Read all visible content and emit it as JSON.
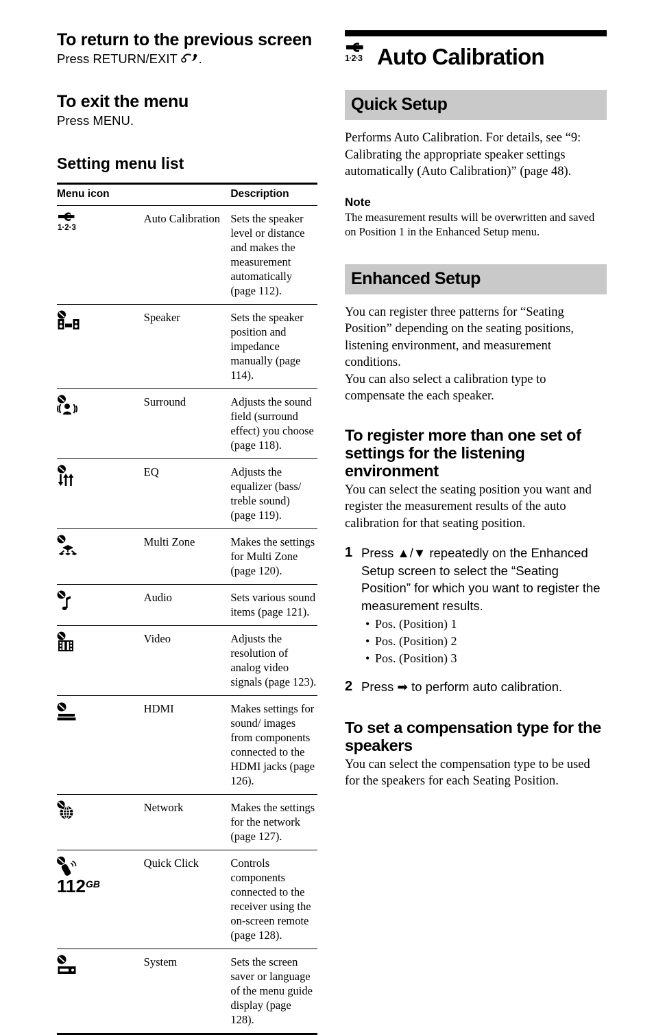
{
  "page": {
    "number": "112",
    "region_suffix": "GB"
  },
  "left_column": {
    "section1": {
      "heading": "To return to the previous screen",
      "body_prefix": "Press RETURN/EXIT ",
      "body_icon": "return-exit-icon",
      "body_suffix": "."
    },
    "section2": {
      "heading": "To exit the menu",
      "body": "Press MENU."
    },
    "section3": {
      "heading": "Setting menu list"
    },
    "table": {
      "columns": [
        "Menu icon",
        "Description"
      ],
      "rows": [
        {
          "icon": "auto-calibration-icon",
          "name": "Auto Calibration",
          "description": "Sets the speaker level or distance and makes the measurement automatically (page 112)."
        },
        {
          "icon": "speaker-icon",
          "name": "Speaker",
          "description": "Sets the speaker position and impedance manually (page 114)."
        },
        {
          "icon": "surround-icon",
          "name": "Surround",
          "description": "Adjusts the sound field (surround effect) you choose (page 118)."
        },
        {
          "icon": "eq-icon",
          "name": "EQ",
          "description": "Adjusts the equalizer (bass/ treble sound) (page 119)."
        },
        {
          "icon": "multi-zone-icon",
          "name": "Multi Zone",
          "description": "Makes the settings for Multi Zone (page 120)."
        },
        {
          "icon": "audio-icon",
          "name": "Audio",
          "description": "Sets various sound items (page 121)."
        },
        {
          "icon": "video-icon",
          "name": "Video",
          "description": "Adjusts the resolution of analog video signals (page 123)."
        },
        {
          "icon": "hdmi-icon",
          "name": "HDMI",
          "description": "Makes settings for sound/ images from components connected to the HDMI jacks (page 126)."
        },
        {
          "icon": "network-icon",
          "name": "Network",
          "description": "Makes the settings for the network (page 127)."
        },
        {
          "icon": "quick-click-icon",
          "name": "Quick Click",
          "description": "Controls components connected to the receiver using the on-screen remote (page 128)."
        },
        {
          "icon": "system-icon",
          "name": "System",
          "description": "Sets the screen saver or language of the menu guide display (page 128)."
        }
      ]
    }
  },
  "right_column": {
    "chapter_title": "Auto Calibration",
    "chapter_icon": "auto-calibration-icon",
    "quick_setup": {
      "heading": "Quick Setup",
      "body": "Performs Auto Calibration. For details, see “9: Calibrating the appropriate speaker settings automatically (Auto Calibration)” (page 48).",
      "note_heading": "Note",
      "note_body": "The measurement results will be overwritten and saved on Position 1 in the Enhanced Setup menu."
    },
    "enhanced_setup": {
      "heading": "Enhanced Setup",
      "body_paragraph1": "You can register three patterns for “Seating Position” depending on the seating positions, listening environment, and measurement conditions.",
      "body_paragraph2": "You can also select a calibration type to compensate the each speaker.",
      "subsection1": {
        "heading": "To register more than one set of settings for the listening environment",
        "intro": "You can select the seating position you want and register the measurement results of the auto calibration for that seating position.",
        "steps": [
          {
            "number": "1",
            "text": "Press ▲/▼ repeatedly on the Enhanced Setup screen to select the “Seating Position” for which you want to register the measurement results."
          },
          {
            "number": "2",
            "text": "Press ➡ to perform auto calibration."
          }
        ],
        "bullets": [
          "Pos. (Position) 1",
          "Pos. (Position) 2",
          "Pos. (Position) 3"
        ]
      },
      "subsection2": {
        "heading": "To set a compensation type for the speakers",
        "body": "You can select the compensation type to be used for the speakers for each Seating Position."
      }
    }
  },
  "colors": {
    "gray_header_bg": "#c9c9c9",
    "text": "#000000",
    "page_bg": "#ffffff"
  }
}
